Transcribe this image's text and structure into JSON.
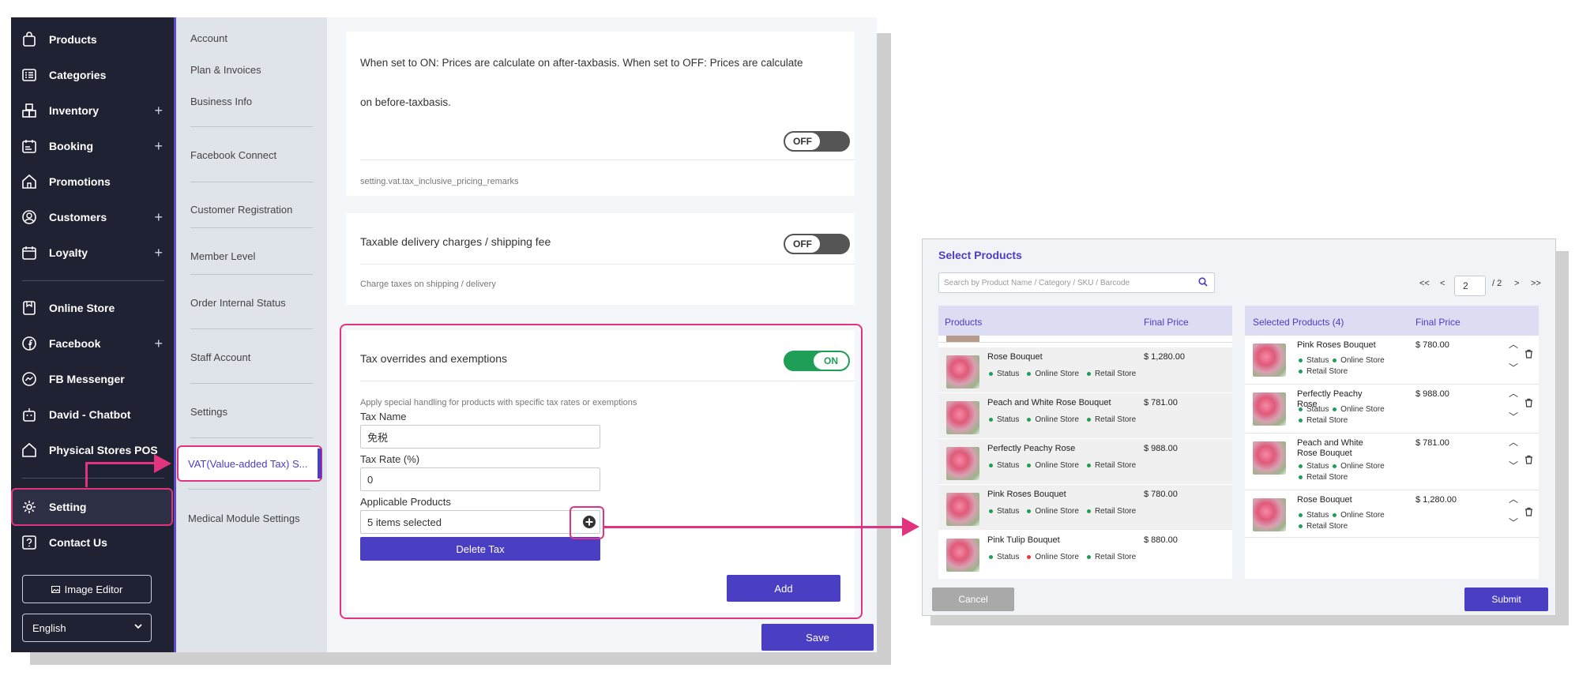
{
  "sidebar": {
    "items": [
      {
        "label": "Products",
        "icon": "bag-icon",
        "expandable": false
      },
      {
        "label": "Categories",
        "icon": "list-icon",
        "expandable": false
      },
      {
        "label": "Inventory",
        "icon": "boxes-icon",
        "expandable": true
      },
      {
        "label": "Booking",
        "icon": "calendar-icon",
        "expandable": true
      },
      {
        "label": "Promotions",
        "icon": "home-tag-icon",
        "expandable": false
      },
      {
        "label": "Customers",
        "icon": "user-icon",
        "expandable": true
      },
      {
        "label": "Loyalty",
        "icon": "calendar-star-icon",
        "expandable": true
      },
      {
        "label": "Online Store",
        "icon": "store-icon",
        "expandable": false
      },
      {
        "label": "Facebook",
        "icon": "facebook-icon",
        "expandable": true
      },
      {
        "label": "FB Messenger",
        "icon": "messenger-icon",
        "expandable": false
      },
      {
        "label": "David - Chatbot",
        "icon": "bot-icon",
        "expandable": false
      },
      {
        "label": "Physical Stores POS",
        "icon": "home-icon",
        "expandable": false
      },
      {
        "label": "Setting",
        "icon": "gear-icon",
        "expandable": false,
        "active": true
      },
      {
        "label": "Contact Us",
        "icon": "help-icon",
        "expandable": false
      }
    ],
    "plus_glyph": "+",
    "image_editor_label": "Image Editor",
    "language_value": "English"
  },
  "subnav": {
    "items": [
      "Account",
      "Plan & Invoices",
      "Business Info",
      "Facebook Connect",
      "Customer Registration",
      "Member Level",
      "Order Internal Status",
      "Staff Account",
      "Settings",
      "VAT(Value-added Tax) S...",
      "Medical Module Settings"
    ]
  },
  "cards": {
    "inclusive_desc_line1": "When set to ON: Prices are calculate on after-taxbasis. When set to OFF: Prices are calculate",
    "inclusive_desc_line2": "on before-taxbasis.",
    "inclusive_toggle": "OFF",
    "inclusive_remarks": "setting.vat.tax_inclusive_pricing_remarks",
    "delivery_title": "Taxable delivery charges / shipping fee",
    "delivery_toggle": "OFF",
    "delivery_desc": "Charge taxes on shipping / delivery",
    "overrides_title": "Tax overrides and exemptions",
    "overrides_toggle": "ON",
    "overrides_desc": "Apply special handling for products with specific tax rates or exemptions",
    "tax_name_label": "Tax Name",
    "tax_name_value": "免税",
    "tax_rate_label": "Tax Rate (%)",
    "tax_rate_value": "0",
    "applicable_label": "Applicable Products",
    "applicable_value": "5 items selected",
    "delete_label": "Delete Tax",
    "add_label": "Add",
    "save_label": "Save"
  },
  "modal": {
    "title": "Select Products",
    "search_placeholder": "Search by Product Name / Category / SKU / Barcode",
    "pager": {
      "first": "<<",
      "prev": "<",
      "current": "2",
      "total": "/ 2",
      "next": ">",
      "last": ">>"
    },
    "products_header": "Products",
    "final_price_header": "Final Price",
    "selected_header": "Selected Products (4)",
    "tag_status": "Status",
    "tag_online": "Online Store",
    "tag_retail": "Retail Store",
    "products": [
      {
        "name": "Rose Bouquet",
        "price": "$ 1,280.00",
        "status": "green"
      },
      {
        "name": "Peach and White Rose Bouquet",
        "price": "$ 781.00",
        "status": "green"
      },
      {
        "name": "Perfectly Peachy Rose",
        "price": "$ 988.00",
        "status": "green"
      },
      {
        "name": "Pink Roses Bouquet",
        "price": "$ 780.00",
        "status": "green"
      },
      {
        "name": "Pink Tulip Bouquet",
        "price": "$ 880.00",
        "status": "red"
      }
    ],
    "selected": [
      {
        "name": "Pink Roses Bouquet",
        "price": "$ 780.00"
      },
      {
        "name": "Perfectly Peachy Rose",
        "price": "$ 988.00"
      },
      {
        "name": "Peach and White Rose Bouquet",
        "price": "$ 781.00"
      },
      {
        "name": "Rose Bouquet",
        "price": "$ 1,280.00"
      }
    ],
    "cancel_label": "Cancel",
    "submit_label": "Submit"
  },
  "colors": {
    "accent": "#4a3ec2",
    "highlight": "#e2337e",
    "toggle_on": "#1e9e57",
    "sidebar_bg": "#1f2233"
  }
}
